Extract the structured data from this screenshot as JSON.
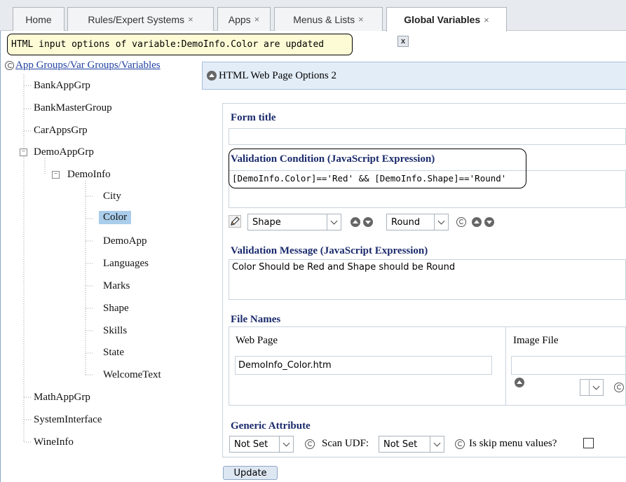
{
  "tabs": [
    {
      "label": "Home",
      "closable": false
    },
    {
      "label": "Rules/Expert Systems",
      "closable": true
    },
    {
      "label": "Apps",
      "closable": true
    },
    {
      "label": "Menus & Lists",
      "closable": true
    },
    {
      "label": "Global Variables",
      "closable": true,
      "active": true
    }
  ],
  "tab_close_glyph": "×",
  "notification": {
    "message": "HTML input options of variable:DemoInfo.Color are updated",
    "close_label": "x"
  },
  "tree": {
    "root_label": "App Groups/Var Groups/Variables",
    "items": [
      {
        "label": "BankAppGrp"
      },
      {
        "label": "BankMasterGroup"
      },
      {
        "label": "CarAppsGrp"
      },
      {
        "label": "DemoAppGrp",
        "expanded": true
      },
      {
        "label": "DemoInfo",
        "expanded": true
      },
      {
        "label": "City"
      },
      {
        "label": "Color",
        "selected": true
      },
      {
        "label": "DemoApp"
      },
      {
        "label": "Languages"
      },
      {
        "label": "Marks"
      },
      {
        "label": "Shape"
      },
      {
        "label": "Skills"
      },
      {
        "label": "State"
      },
      {
        "label": "WelcomeText"
      },
      {
        "label": "MathAppGrp"
      },
      {
        "label": "SystemInterface"
      },
      {
        "label": "WineInfo"
      }
    ],
    "expander_glyph": "−"
  },
  "panel": {
    "title": "HTML Web Page Options 2",
    "form_title_label": "Form title",
    "form_title_value": "",
    "validation_condition_label": "Validation Condition (JavaScript Expression)",
    "validation_condition_value": "[DemoInfo.Color]=='Red' && [DemoInfo.Shape]=='Round'",
    "variable_select": "Shape",
    "value_select": "Round",
    "validation_message_label": "Validation Message (JavaScript Expression)",
    "validation_message_value": "Color Should be Red and Shape should be Round",
    "file_names_label": "File Names",
    "web_page_label": "Web Page",
    "web_page_value": "DemoInfo_Color.htm",
    "image_file_label": "Image File",
    "image_file_value": "",
    "image_select_value": "",
    "generic_attribute_label": "Generic Attribute",
    "generic_attribute_value": "Not Set",
    "scan_udf_label": "Scan UDF:",
    "scan_udf_value": "Not Set",
    "skip_menu_label": "Is skip menu values?",
    "skip_menu_checked": false,
    "update_label": "Update"
  },
  "colors": {
    "selection": "#a9cdea",
    "header_bg": "#e3edf8",
    "label_blue": "#1a2a6c",
    "notify_bg": "#fdfbd5"
  },
  "icons": [
    "circular-arrow-icon",
    "up-arrow-circle-icon",
    "down-arrow-circle-icon",
    "pencil-icon",
    "close-icon",
    "checkbox-icon"
  ]
}
